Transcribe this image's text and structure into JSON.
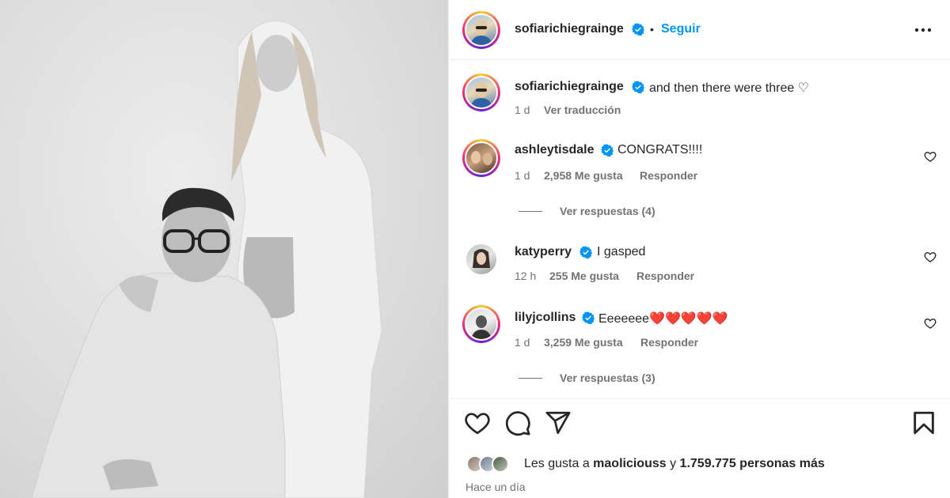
{
  "post": {
    "author": "sofiarichiegrainge",
    "follow_label": "Seguir",
    "separator": "•",
    "caption": "and then there were three ♡",
    "caption_time": "1 d",
    "translate_label": "Ver traducción"
  },
  "comments": [
    {
      "user": "ashleytisdale",
      "text": "CONGRATS!!!!",
      "time": "1 d",
      "likes": "2,958 Me gusta",
      "reply_label": "Responder",
      "view_replies": "Ver respuestas (4)"
    },
    {
      "user": "katyperry",
      "text": "I gasped",
      "time": "12 h",
      "likes": "255 Me gusta",
      "reply_label": "Responder"
    },
    {
      "user": "lilyjcollins",
      "text": "Eeeeeee❤️❤️❤️❤️❤️",
      "time": "1 d",
      "likes": "3,259 Me gusta",
      "reply_label": "Responder",
      "view_replies": "Ver respuestas (3)"
    }
  ],
  "likes_summary": {
    "prefix": "Les gusta a ",
    "user": "maoliciouss",
    "middle": " y ",
    "count": "1.759.775 personas más"
  },
  "posted_time": "Hace un día",
  "colors": {
    "accent": "#0095f6",
    "verified": "#0095f6",
    "heart": "#ed1d3a"
  },
  "icons": [
    "verified-icon",
    "more-icon",
    "heart-icon",
    "comment-icon",
    "share-icon",
    "bookmark-icon"
  ]
}
